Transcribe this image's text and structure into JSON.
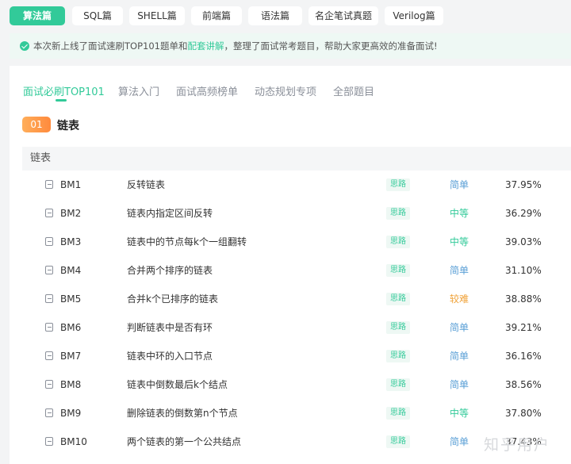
{
  "categories": [
    {
      "label": "算法篇",
      "active": true
    },
    {
      "label": "SQL篇",
      "active": false
    },
    {
      "label": "SHELL篇",
      "active": false
    },
    {
      "label": "前端篇",
      "active": false
    },
    {
      "label": "语法篇",
      "active": false
    },
    {
      "label": "名企笔试真题",
      "active": false
    },
    {
      "label": "Verilog篇",
      "active": false
    }
  ],
  "notice": {
    "before": "本次新上线了面试速刷TOP101题单和",
    "link": "配套讲解",
    "after": "，整理了面试常考题目，帮助大家更高效的准备面试!"
  },
  "tabs": [
    {
      "label": "面试必刷TOP101",
      "active": true
    },
    {
      "label": "算法入门",
      "active": false
    },
    {
      "label": "面试高频榜单",
      "active": false
    },
    {
      "label": "动态规划专项",
      "active": false
    },
    {
      "label": "全部题目",
      "active": false
    }
  ],
  "section": {
    "number": "01",
    "title": "链表"
  },
  "group": {
    "title": "链表"
  },
  "problems": [
    {
      "id": "BM1",
      "title": "反转链表",
      "tag": "思路",
      "difficulty": "简单",
      "level": "easy",
      "rate": "37.95%"
    },
    {
      "id": "BM2",
      "title": "链表内指定区间反转",
      "tag": "思路",
      "difficulty": "中等",
      "level": "mid",
      "rate": "36.29%"
    },
    {
      "id": "BM3",
      "title": "链表中的节点每k个一组翻转",
      "tag": "思路",
      "difficulty": "中等",
      "level": "mid",
      "rate": "39.03%"
    },
    {
      "id": "BM4",
      "title": "合并两个排序的链表",
      "tag": "思路",
      "difficulty": "简单",
      "level": "easy",
      "rate": "31.10%"
    },
    {
      "id": "BM5",
      "title": "合并k个已排序的链表",
      "tag": "思路",
      "difficulty": "较难",
      "level": "hard",
      "rate": "38.88%"
    },
    {
      "id": "BM6",
      "title": "判断链表中是否有环",
      "tag": "思路",
      "difficulty": "简单",
      "level": "easy",
      "rate": "39.21%"
    },
    {
      "id": "BM7",
      "title": "链表中环的入口节点",
      "tag": "思路",
      "difficulty": "简单",
      "level": "easy",
      "rate": "36.16%"
    },
    {
      "id": "BM8",
      "title": "链表中倒数最后k个结点",
      "tag": "思路",
      "difficulty": "简单",
      "level": "easy",
      "rate": "38.56%"
    },
    {
      "id": "BM9",
      "title": "删除链表的倒数第n个节点",
      "tag": "思路",
      "difficulty": "中等",
      "level": "mid",
      "rate": "37.80%"
    },
    {
      "id": "BM10",
      "title": "两个链表的第一个公共结点",
      "tag": "思路",
      "difficulty": "简单",
      "level": "easy",
      "rate": "37.43%"
    }
  ],
  "watermark": "知乎用户",
  "colors": {
    "accent": "#32ca99",
    "easy": "#5a9fd6",
    "mid": "#32ca99",
    "hard": "#f0a33a"
  }
}
